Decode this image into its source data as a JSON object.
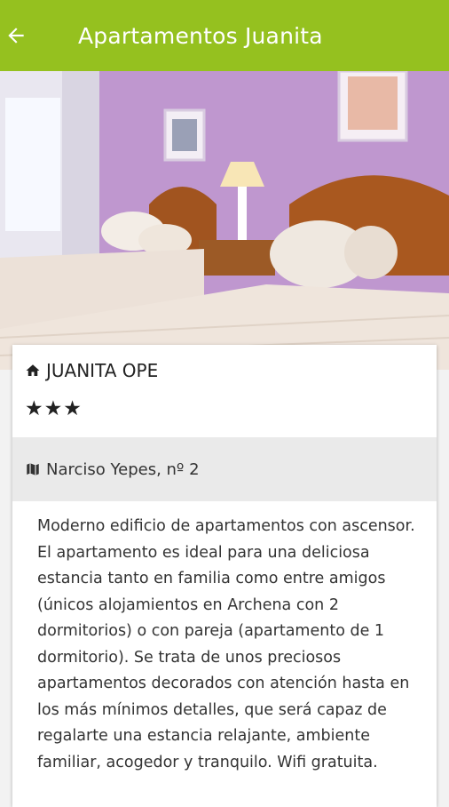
{
  "appbar": {
    "title": "Apartamentos Juanita",
    "back_icon": "arrow-left-icon",
    "color": "#95c11f"
  },
  "hero": {
    "icon": "bedroom-photo"
  },
  "listing": {
    "name": "JUANITA OPE",
    "name_icon": "home-icon",
    "stars": "★★★",
    "address": "Narciso Yepes, nº 2",
    "address_icon": "map-icon",
    "description": "Moderno edificio de apartamentos con ascensor. El apartamento es ideal para una deliciosa estancia tanto en familia como entre amigos (únicos alojamientos en Archena con 2 dormitorios) o con pareja (apartamento de 1 dormitorio). Se trata de unos preciosos apartamentos decorados con atención hasta en los más mínimos detalles, que será capaz de regalarte una estancia relajante, ambiente familiar, acogedor y tranquilo. Wifi gratuita."
  }
}
